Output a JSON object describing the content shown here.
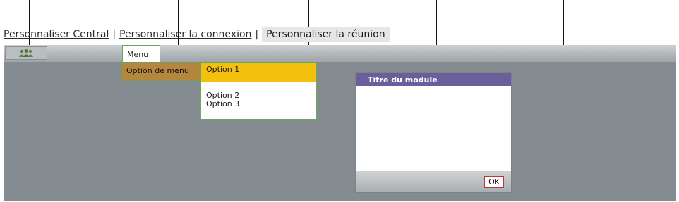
{
  "links": {
    "item1": "Personnaliser Central",
    "separator1": "|",
    "item2": "Personnaliser la connexion",
    "separator2": "|",
    "item3": "Personnaliser la réunion"
  },
  "toolbar": {
    "home_icon": "people-icon",
    "menu_label": "Menu"
  },
  "menu": {
    "main_item": "Option de menu",
    "options": [
      "Option 1",
      "Option 2",
      "Option 3"
    ]
  },
  "module": {
    "title": "Titre du module",
    "ok_label": "OK"
  },
  "colors": {
    "app_background": "#858c91",
    "menu_highlight": "#b4873f",
    "option_highlight": "#f4c00e",
    "module_title_bar": "#6a5f9b",
    "menu_border": "#6aa85a",
    "ok_border": "#b03a3a"
  }
}
